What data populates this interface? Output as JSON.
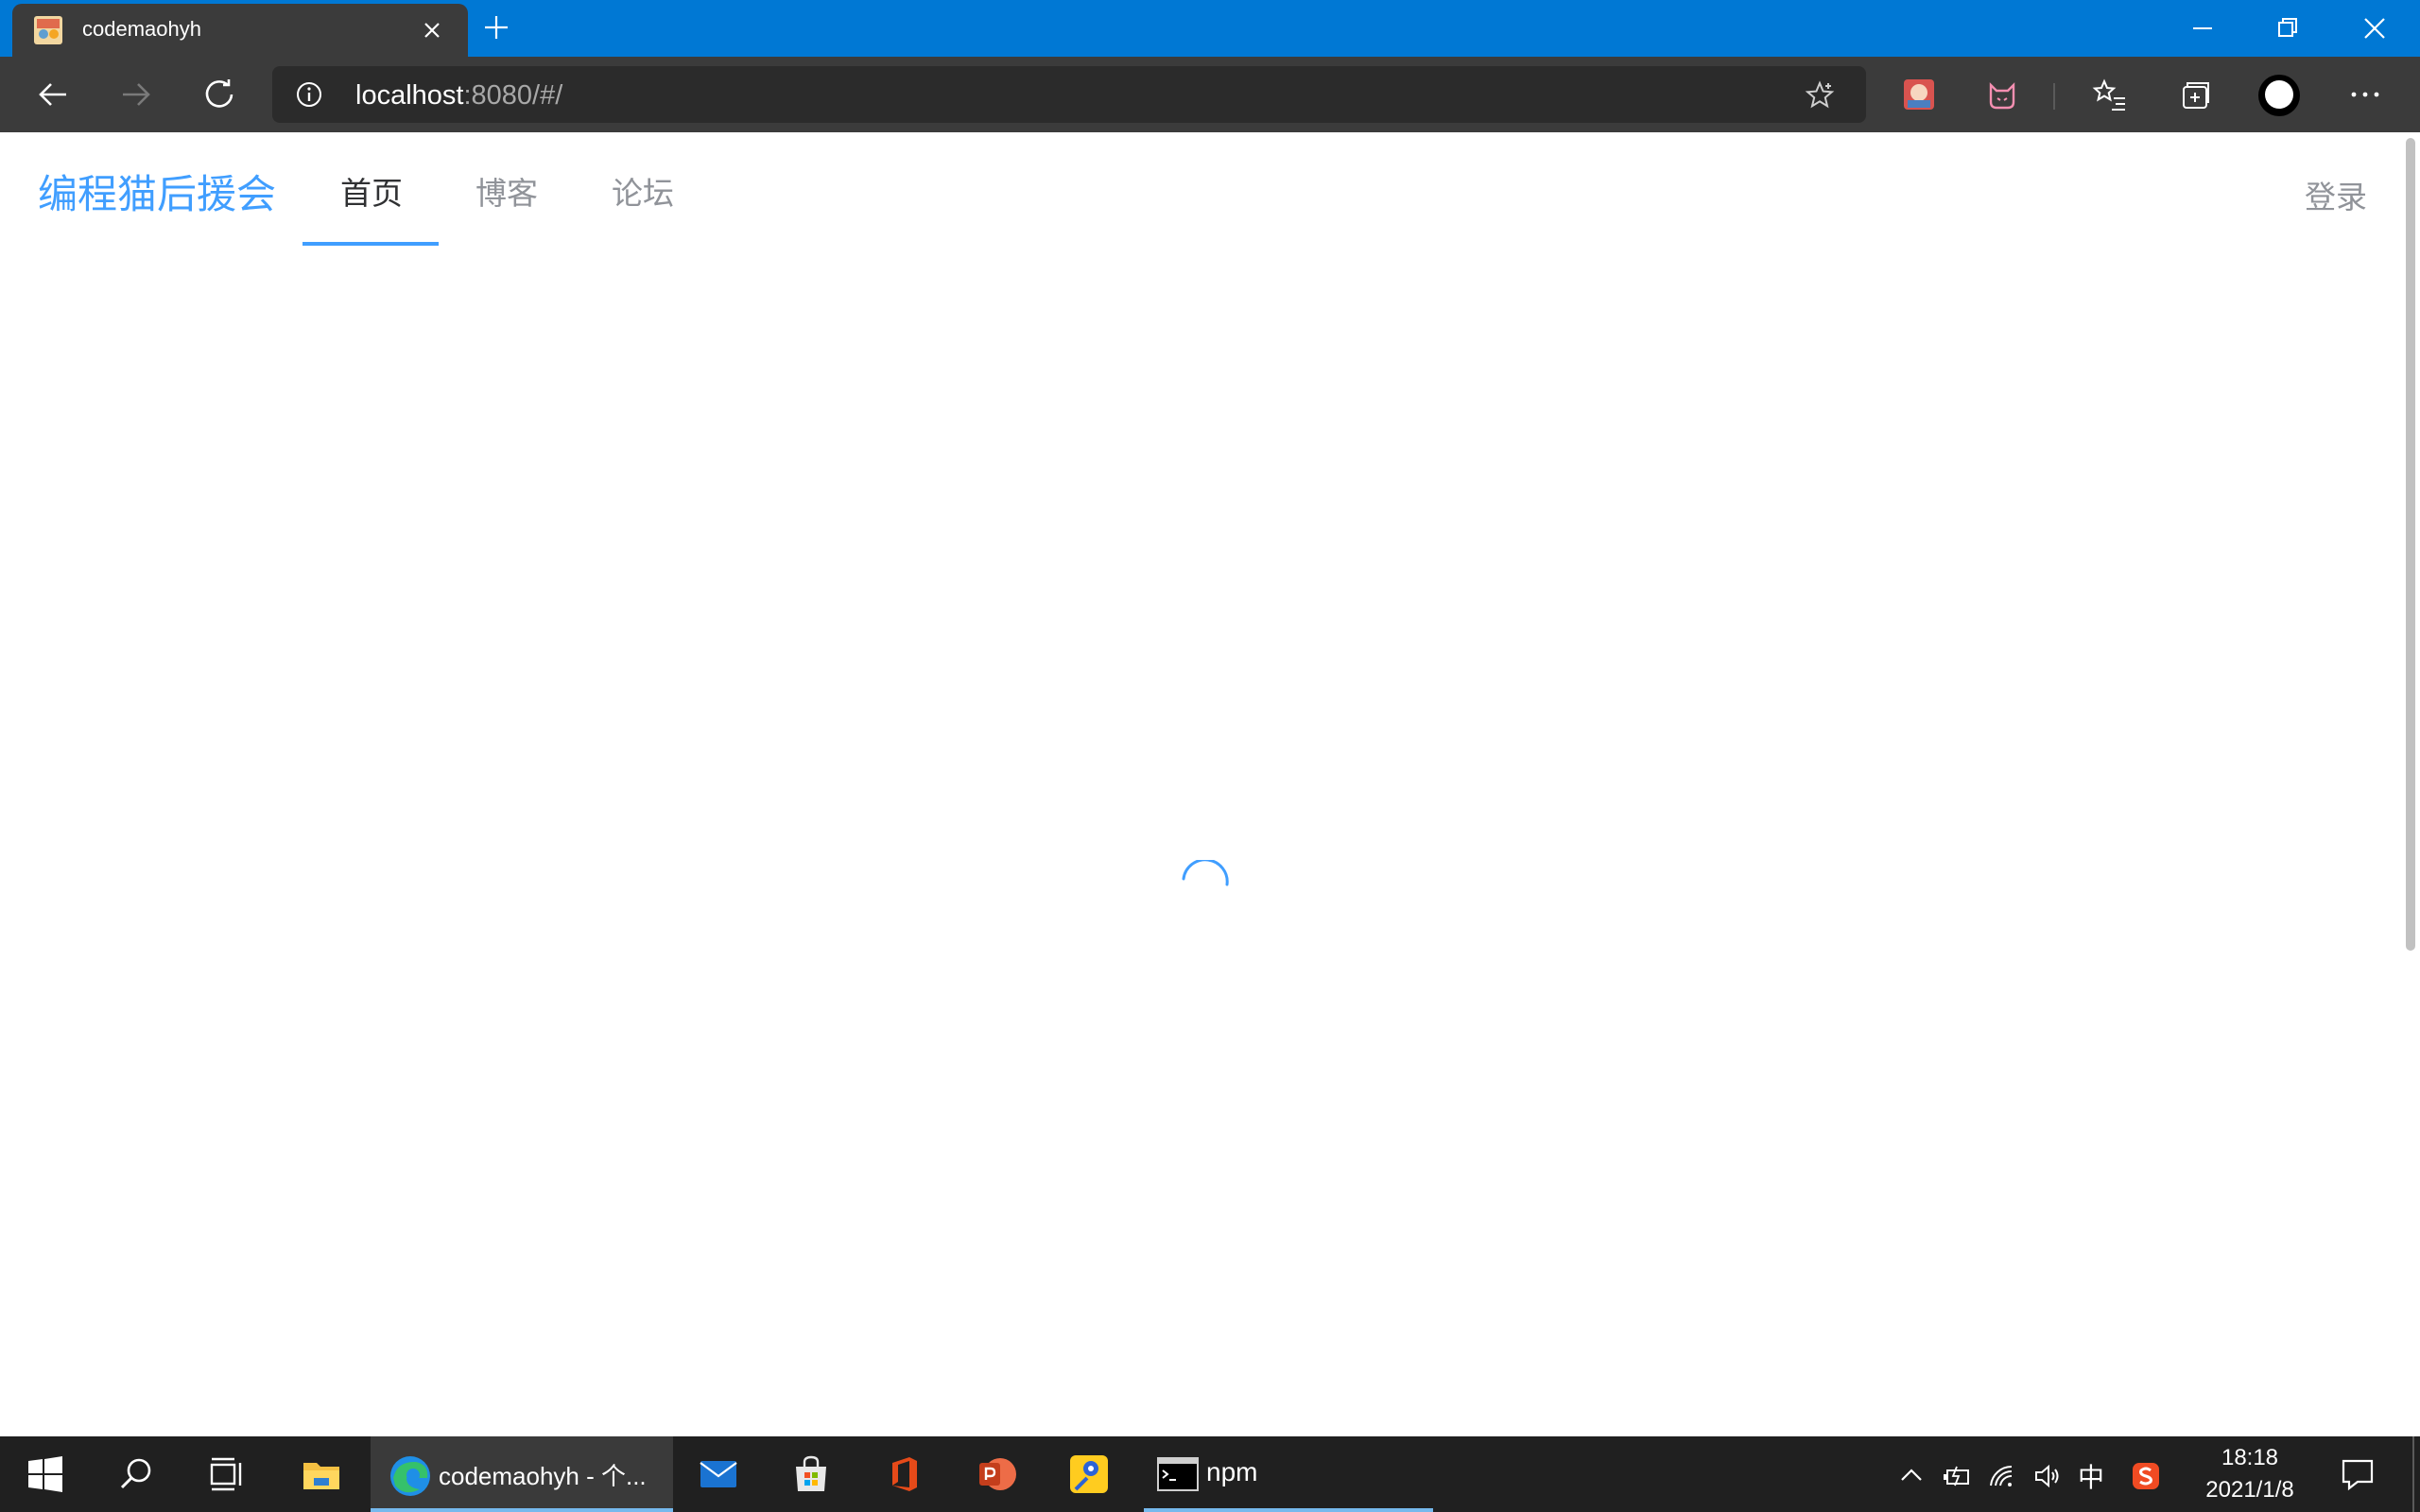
{
  "browser": {
    "tab": {
      "title": "codemaohyh"
    },
    "address": {
      "host": "localhost",
      "path": ":8080/#/"
    }
  },
  "site": {
    "logo": "编程猫后援会",
    "nav": [
      {
        "label": "首页",
        "active": true
      },
      {
        "label": "博客",
        "active": false
      },
      {
        "label": "论坛",
        "active": false
      }
    ],
    "login_label": "登录",
    "accent_color": "#409eff"
  },
  "taskbar": {
    "edge_label": "codemaohyh - 个...",
    "npm_label": "npm",
    "ime_label": "中",
    "clock": {
      "time": "18:18",
      "date": "2021/1/8"
    }
  },
  "colors": {
    "titlebar": "#0078d4",
    "toolbar": "#3b3b3b",
    "taskbar": "#202020"
  }
}
